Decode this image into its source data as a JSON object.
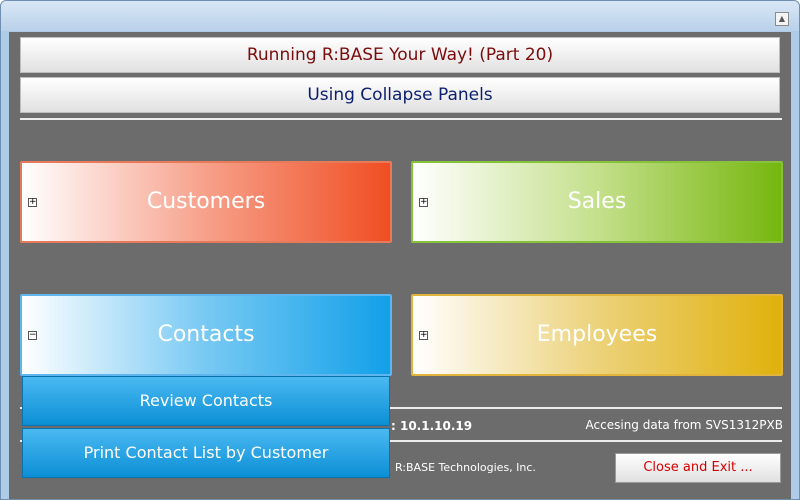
{
  "window": {
    "maximize_icon": "maximize-icon"
  },
  "header": {
    "title": "Running R:BASE Your Way! (Part 20)",
    "subtitle": "Using Collapse Panels"
  },
  "panels": [
    {
      "label": "Customers",
      "state": "collapsed",
      "toggle": "+",
      "color": "#f04e22"
    },
    {
      "label": "Sales",
      "state": "collapsed",
      "toggle": "+",
      "color": "#76b70e"
    },
    {
      "label": "Contacts",
      "state": "expanded",
      "toggle": "−",
      "color": "#12a0e9",
      "items": [
        "Review Contacts",
        "Print Contact List by Customer"
      ]
    },
    {
      "label": "Employees",
      "state": "collapsed",
      "toggle": "+",
      "color": "#e0b10c"
    }
  ],
  "footer": {
    "version_text": ": 10.1.10.19",
    "access_text": "Accesing data from SVS1312PXB",
    "copyright_text": "R:BASE Technologies, Inc.",
    "exit_label": "Close and Exit ..."
  }
}
